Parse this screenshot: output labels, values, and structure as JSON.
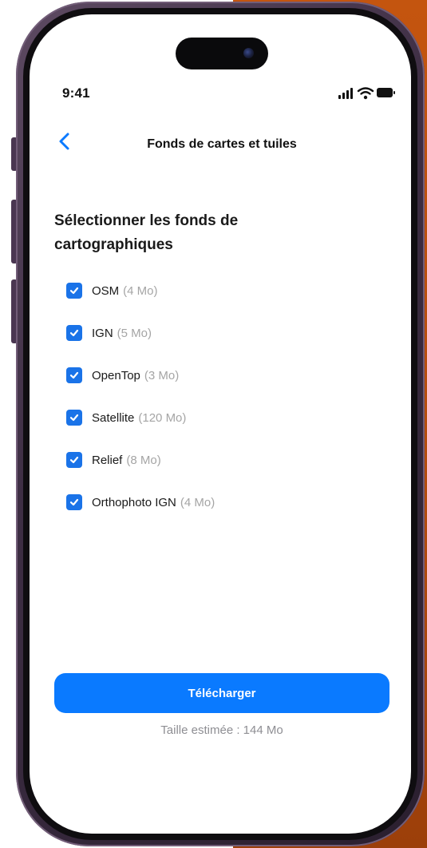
{
  "status_bar": {
    "time": "9:41",
    "icons": [
      "signal-icon",
      "wifi-icon",
      "battery-icon"
    ]
  },
  "nav": {
    "back_icon": "chevron-left-icon",
    "title": "Fonds de cartes et tuiles"
  },
  "section": {
    "heading": "Sélectionner les fonds de cartographiques"
  },
  "layers": [
    {
      "label": "OSM",
      "size": "(4 Mo)",
      "checked": true
    },
    {
      "label": "IGN",
      "size": "(5 Mo)",
      "checked": true
    },
    {
      "label": "OpenTop",
      "size": "(3 Mo)",
      "checked": true
    },
    {
      "label": "Satellite",
      "size": "(120 Mo)",
      "checked": true
    },
    {
      "label": "Relief",
      "size": "(8 Mo)",
      "checked": true
    },
    {
      "label": "Orthophoto IGN",
      "size": "(4 Mo)",
      "checked": true
    }
  ],
  "footer": {
    "download_label": "Télécharger",
    "estimate": "Taille estimée : 144 Mo"
  },
  "colors": {
    "accent": "#0a7aff",
    "checkbox": "#1a73e8",
    "muted_text": "#a5a5a5",
    "background_accent": "#c4550f",
    "frame": "#4a3651"
  }
}
